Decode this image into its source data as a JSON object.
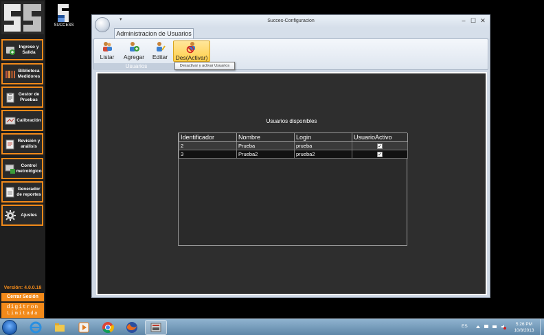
{
  "app": {
    "small_logo_text": "SUCCESS",
    "version": "Versión: 4.0.0.18",
    "logout_label": "Cerrar Sesión",
    "brand_line1": "digitron",
    "brand_line2": "Limitada"
  },
  "sidebar": {
    "items": [
      {
        "label": "Ingreso y Salida",
        "icon": "login-icon"
      },
      {
        "label": "Biblioteca Medidores",
        "icon": "library-icon"
      },
      {
        "label": "Gestor de Pruebas",
        "icon": "clipboard-icon"
      },
      {
        "label": "Calibración",
        "icon": "calibration-icon"
      },
      {
        "label": "Revisión y análisis",
        "icon": "review-icon"
      },
      {
        "label": "Control metrológico",
        "icon": "control-icon"
      },
      {
        "label": "Generador de reportes",
        "icon": "report-icon"
      },
      {
        "label": "Ajustes",
        "icon": "gear-icon"
      }
    ]
  },
  "window": {
    "title": "Succes-Configuracion",
    "qat": "▾",
    "tab": "Administracion de Usuarios",
    "controls": {
      "minimize": "–",
      "maximize": "☐",
      "close": "✕"
    },
    "ribbon": {
      "group_label": "Usuarios",
      "buttons": [
        {
          "label": "Listar",
          "icon": "users-list-icon"
        },
        {
          "label": "Agregar",
          "icon": "user-add-icon"
        },
        {
          "label": "Editar",
          "icon": "user-edit-icon"
        },
        {
          "label": "Des(Activar)",
          "icon": "user-disable-icon"
        }
      ]
    },
    "tooltip": "Desactivar y activar Usuarios"
  },
  "content": {
    "title": "Usuarios disponibles",
    "columns": [
      "Identificador",
      "Nombre",
      "Login",
      "UsuarioActivo"
    ],
    "rows": [
      {
        "id": "2",
        "nombre": "Prueba",
        "login": "prueba",
        "activo": true
      },
      {
        "id": "3",
        "nombre": "Prueba2",
        "login": "prueba2",
        "activo": true
      }
    ]
  },
  "taskbar": {
    "items": [
      {
        "name": "internet-explorer-icon",
        "open": false
      },
      {
        "name": "file-explorer-icon",
        "open": false
      },
      {
        "name": "media-player-icon",
        "open": false
      },
      {
        "name": "chrome-icon",
        "open": false
      },
      {
        "name": "firefox-icon",
        "open": false
      },
      {
        "name": "success-app-icon",
        "open": true
      }
    ],
    "lang": "ES",
    "time": "5:26 PM",
    "date": "10/8/2013"
  },
  "colors": {
    "accent": "#f28a1a",
    "content_bg": "#2e2e2e",
    "ribbon_active": "#ffcf4a"
  }
}
